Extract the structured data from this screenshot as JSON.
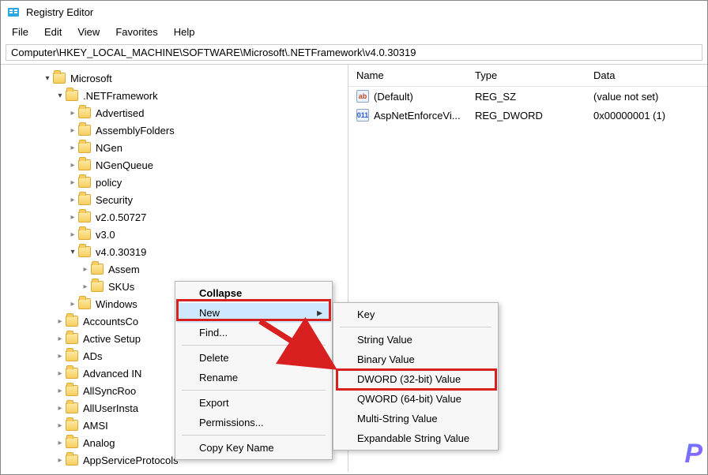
{
  "title": "Registry Editor",
  "menubar": [
    "File",
    "Edit",
    "View",
    "Favorites",
    "Help"
  ],
  "address": "Computer\\HKEY_LOCAL_MACHINE\\SOFTWARE\\Microsoft\\.NETFramework\\v4.0.30319",
  "tree": {
    "root": "Microsoft",
    "netfw": ".NETFramework",
    "children": [
      "Advertised",
      "AssemblyFolders",
      "NGen",
      "NGenQueue",
      "policy",
      "Security",
      "v2.0.50727",
      "v3.0"
    ],
    "v4": "v4.0.30319",
    "v4children": [
      "Assem",
      "SKUs"
    ],
    "afterV4": "Windows",
    "after": [
      "AccountsCo",
      "Active Setup",
      "ADs",
      "Advanced IN",
      "AllSyncRoo",
      "AllUserInsta",
      "AMSI",
      "Analog",
      "AppServiceProtocols"
    ]
  },
  "values": {
    "headers": {
      "name": "Name",
      "type": "Type",
      "data": "Data"
    },
    "rows": [
      {
        "icon": "ab",
        "name": "(Default)",
        "type": "REG_SZ",
        "data": "(value not set)"
      },
      {
        "icon": "011",
        "name": "AspNetEnforceVi...",
        "type": "REG_DWORD",
        "data": "0x00000001 (1)"
      }
    ]
  },
  "ctx1": {
    "collapse": "Collapse",
    "new": "New",
    "find": "Find...",
    "delete": "Delete",
    "rename": "Rename",
    "export": "Export",
    "permissions": "Permissions...",
    "copykey": "Copy Key Name"
  },
  "ctx2": {
    "key": "Key",
    "string": "String Value",
    "binary": "Binary Value",
    "dword": "DWORD (32-bit) Value",
    "qword": "QWORD (64-bit) Value",
    "multi": "Multi-String Value",
    "expand": "Expandable String Value"
  }
}
